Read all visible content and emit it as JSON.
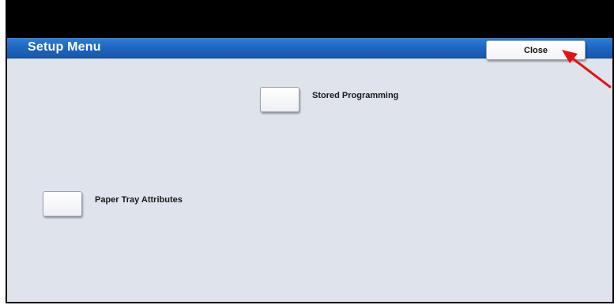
{
  "window": {
    "title": "Setup Menu"
  },
  "toolbar": {
    "close_label": "Close"
  },
  "options": [
    {
      "label": "Stored Programming"
    },
    {
      "label": "Paper Tray Attributes"
    }
  ],
  "colors": {
    "title_bar": "#1c64bd",
    "screen_background": "#dfe3ec",
    "annotation_arrow": "#e11414"
  }
}
